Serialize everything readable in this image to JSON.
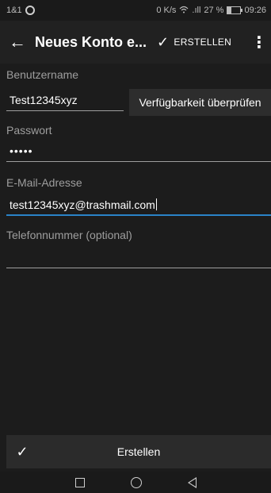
{
  "status_bar": {
    "carrier": "1&1",
    "speed": "0 K/s",
    "signal": ".ıll",
    "battery_percent": "27 %",
    "battery_level": 0.27,
    "time": "09:26"
  },
  "toolbar": {
    "back_icon": "←",
    "title": "Neues Konto e...",
    "create_check_icon": "✓",
    "create_label": "ERSTELLEN",
    "overflow_icon": "⋮"
  },
  "form": {
    "username_label": "Benutzername",
    "username_value": "Test12345xyz",
    "check_button_label": "Verfügbarkeit überprüfen",
    "password_label": "Passwort",
    "password_value": "•••••",
    "email_label": "E-Mail-Adresse",
    "email_value": "test12345xyz@trashmail.com",
    "phone_label": "Telefonnummer (optional)",
    "phone_value": ""
  },
  "bottom_button": {
    "check_icon": "✓",
    "label": "Erstellen"
  },
  "icons": {
    "wifi": "wifi-icon",
    "battery": "battery-icon",
    "nav_square": "recents-icon",
    "nav_circle": "home-icon",
    "nav_triangle": "back-triangle-icon"
  },
  "colors": {
    "background": "#1c1c1c",
    "toolbar": "#212121",
    "focus_accent": "#2a83c8",
    "label": "#9e9e9e"
  }
}
